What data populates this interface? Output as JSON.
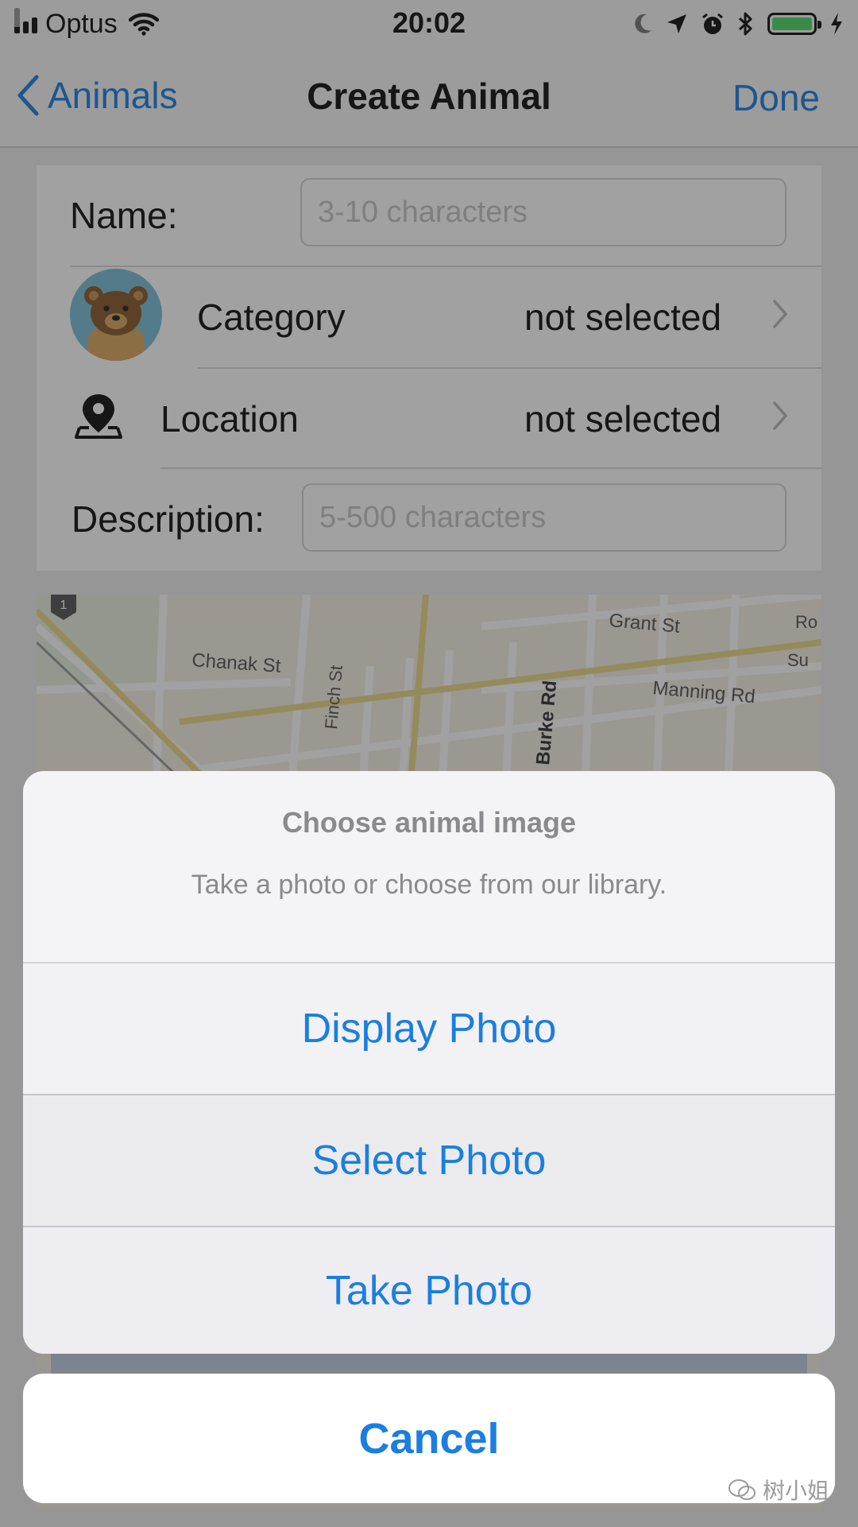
{
  "status_bar": {
    "carrier": "Optus",
    "time": "20:02",
    "battery_color": "#4cd964"
  },
  "nav": {
    "back_label": "Animals",
    "title": "Create Animal",
    "done_label": "Done"
  },
  "form": {
    "name_label": "Name:",
    "name_placeholder": "3-10 characters",
    "category_label": "Category",
    "category_value": "not selected",
    "location_label": "Location",
    "location_value": "not selected",
    "description_label": "Description:",
    "description_placeholder": "5-500 characters"
  },
  "map": {
    "street_labels": [
      "Grant St",
      "Chanak St",
      "Manning Rd",
      "Burke Rd",
      "Finch St",
      "Su",
      "Ro",
      "1"
    ]
  },
  "action_sheet": {
    "title": "Choose animal image",
    "message": "Take a photo or choose from our library.",
    "buttons": [
      "Display Photo",
      "Select Photo",
      "Take Photo"
    ],
    "cancel_label": "Cancel"
  },
  "watermark": {
    "text": "树小姐"
  },
  "colors": {
    "accent": "#1b7ee0",
    "overlay": "rgba(30,30,30,0.42)"
  }
}
